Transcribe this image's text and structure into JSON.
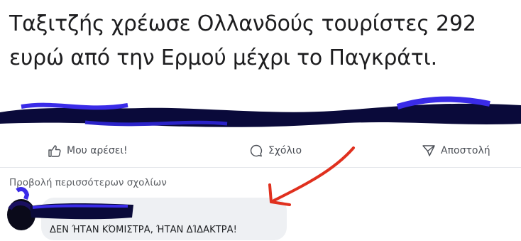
{
  "post": {
    "headline_line1": "Ταξιτζής χρέωσε Ολλανδούς τουρίστες 292",
    "headline_line2": "ευρώ από την Ερμού μέχρι το Παγκράτι."
  },
  "actions": {
    "like_label": "Μου αρέσει!",
    "comment_label": "Σχόλιο",
    "share_label": "Αποστολή"
  },
  "comments": {
    "more_label": "Προβολή περισσότερων σχολίων",
    "items": [
      {
        "text": "ΔΕΝ ΉΤΑΝ ΚΌΜΙΣΤΡΑ, ΉΤΑΝ ΔΊΔΑΚΤΡΑ!"
      }
    ]
  },
  "icons": {
    "like": "thumbs-up-icon",
    "comment": "speech-bubble-icon",
    "share": "send-icon"
  },
  "colors": {
    "redaction": "#0a0a3a",
    "redaction_highlight": "#3a2be8",
    "annotation_arrow": "#e0301e"
  }
}
